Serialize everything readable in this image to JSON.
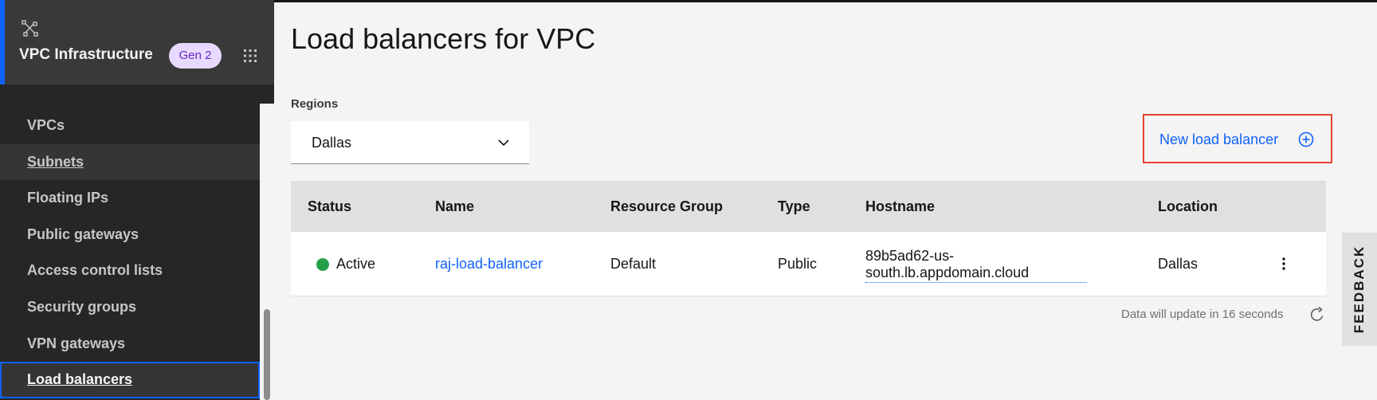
{
  "app": {
    "title": "VPC Infrastructure",
    "badge": "Gen 2",
    "icons": {
      "logo": "vpc-network-icon",
      "switcher": "app-grid-icon"
    }
  },
  "sidebar": {
    "items": [
      {
        "label": "VPCs",
        "state": "default"
      },
      {
        "label": "Subnets",
        "state": "hover"
      },
      {
        "label": "Floating IPs",
        "state": "default"
      },
      {
        "label": "Public gateways",
        "state": "default"
      },
      {
        "label": "Access control lists",
        "state": "default"
      },
      {
        "label": "Security groups",
        "state": "default"
      },
      {
        "label": "VPN gateways",
        "state": "default"
      },
      {
        "label": "Load balancers",
        "state": "active"
      }
    ]
  },
  "main": {
    "title": "Load balancers for VPC",
    "regions": {
      "label": "Regions",
      "value": "Dallas"
    },
    "new_button": {
      "label": "New load balancer",
      "icon": "add-circle-icon"
    },
    "table": {
      "columns": [
        "Status",
        "Name",
        "Resource Group",
        "Type",
        "Hostname",
        "Location"
      ],
      "rows": [
        {
          "status": "Active",
          "name": "raj-load-balancer",
          "resource_group": "Default",
          "type": "Public",
          "hostname_line1": "89b5ad62-us-",
          "hostname_line2": "south.lb.appdomain.cloud",
          "location": "Dallas"
        }
      ]
    },
    "update_text": "Data will update in 16 seconds"
  },
  "feedback": {
    "label": "FEEDBACK"
  },
  "colors": {
    "accent": "#0f62fe",
    "sidebar_bg": "#262626",
    "status_active": "#24a148",
    "highlight_border": "#e8412b",
    "badge_bg": "#e8daff",
    "badge_text": "#6929c4"
  }
}
